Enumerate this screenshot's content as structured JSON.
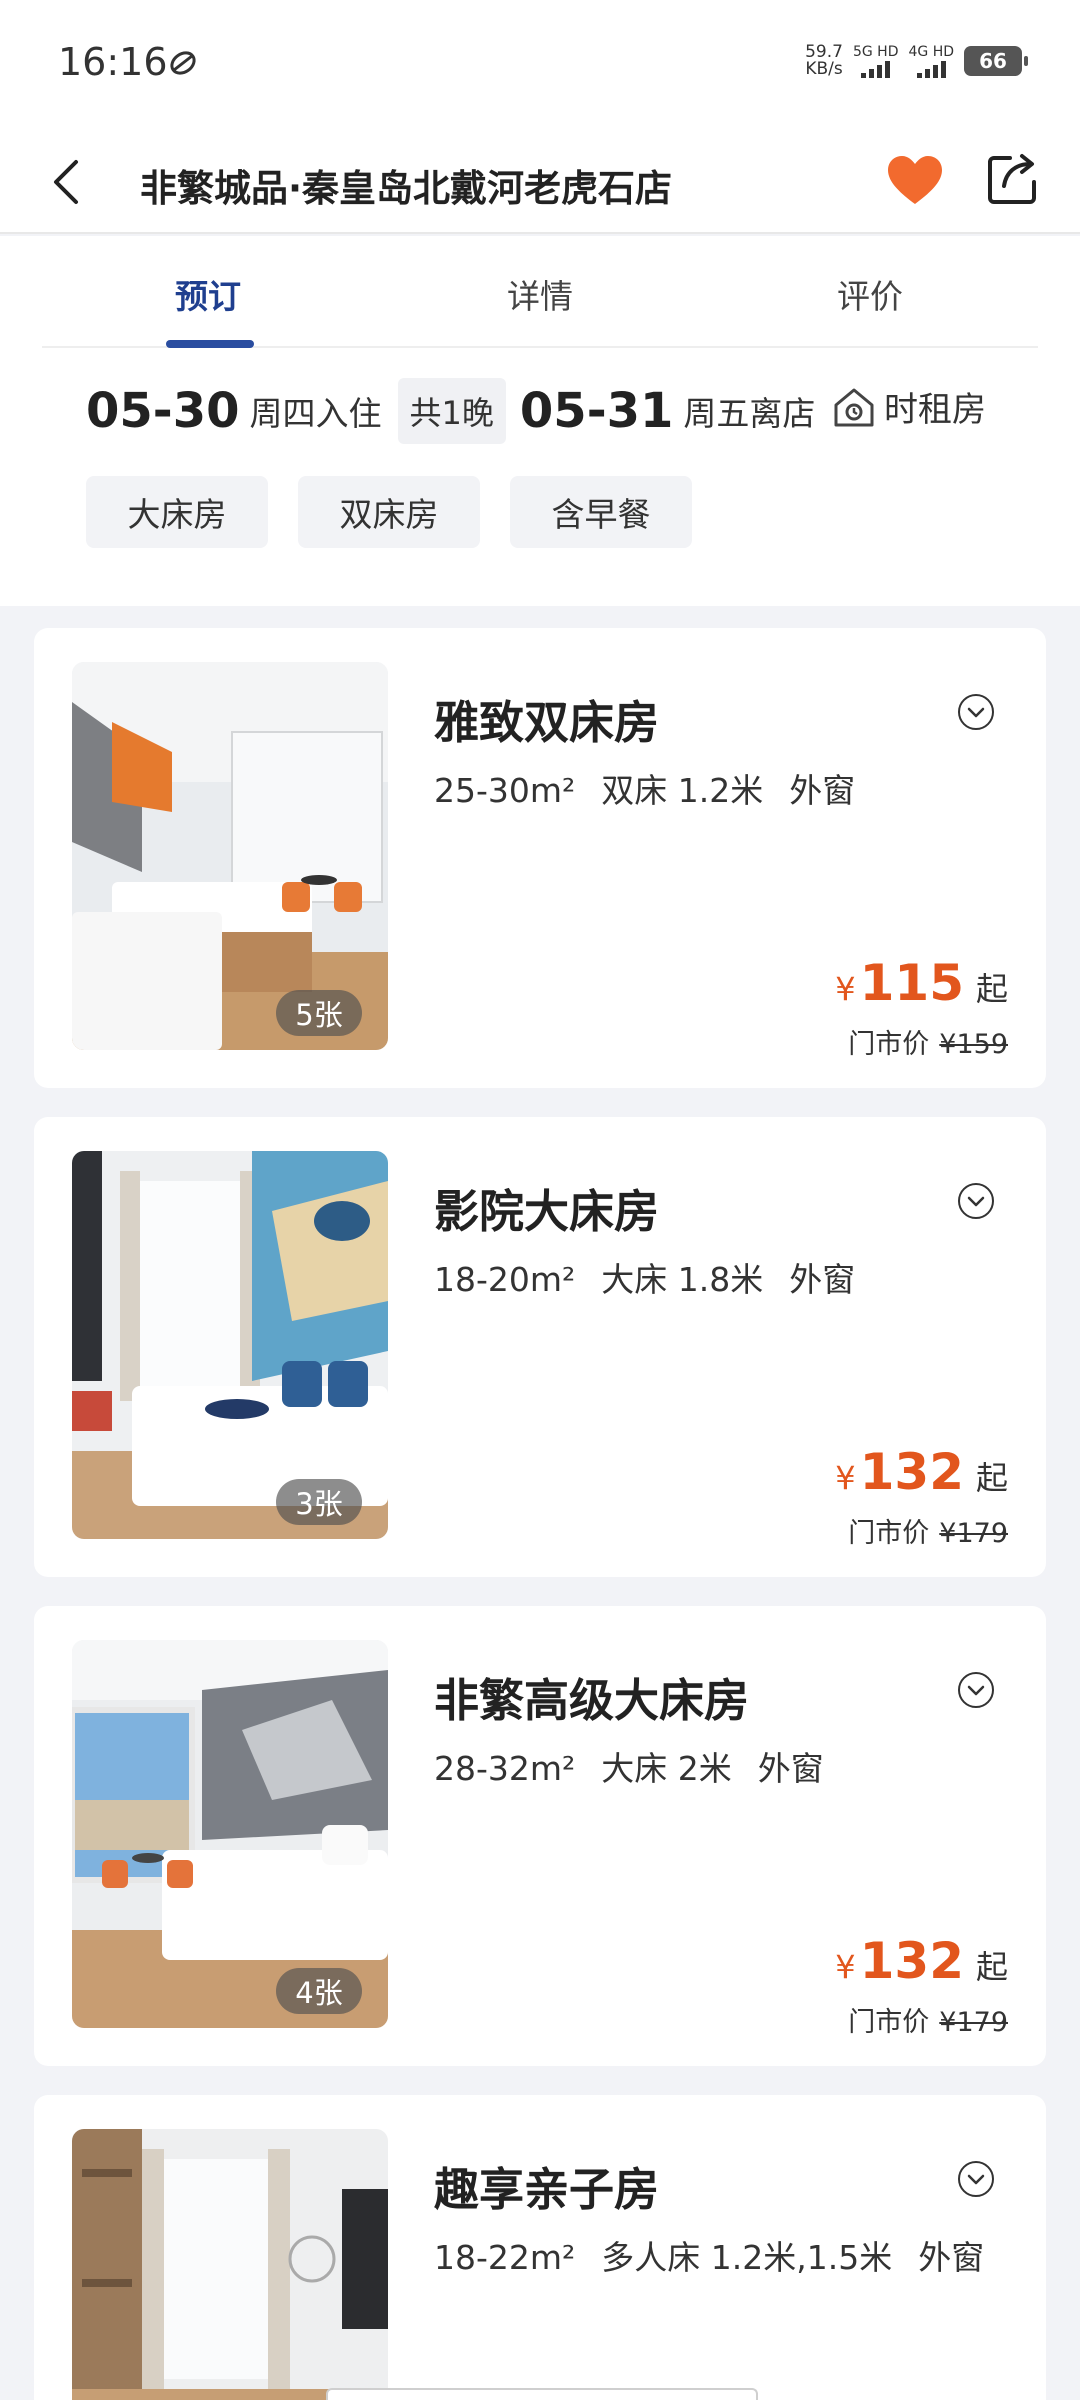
{
  "status": {
    "time": "16:16",
    "speed_value": "59.7",
    "speed_unit": "KB/s",
    "net1": "5G HD",
    "net2": "4G HD",
    "battery": "66"
  },
  "header": {
    "title": "非繁城品·秦皇岛北戴河老虎石店",
    "favorite_color": "#f26a2e"
  },
  "tabs": [
    {
      "label": "预订",
      "active": true
    },
    {
      "label": "详情",
      "active": false
    },
    {
      "label": "评价",
      "active": false
    }
  ],
  "dates": {
    "checkin_date": "05-30",
    "checkin_label": "周四入住",
    "nights": "共1晚",
    "checkout_date": "05-31",
    "checkout_label": "周五离店",
    "hourly_label": "时租房"
  },
  "filters": [
    "大床房",
    "双床房",
    "含早餐"
  ],
  "rooms": [
    {
      "name": "雅致双床房",
      "area": "25-30m²",
      "bed": "双床 1.2米",
      "window": "外窗",
      "photo_count": "5张",
      "currency": "¥",
      "price": "115",
      "price_suffix": "起",
      "market_label": "门市价",
      "market_price": "¥159"
    },
    {
      "name": "影院大床房",
      "area": "18-20m²",
      "bed": "大床 1.8米",
      "window": "外窗",
      "photo_count": "3张",
      "currency": "¥",
      "price": "132",
      "price_suffix": "起",
      "market_label": "门市价",
      "market_price": "¥179"
    },
    {
      "name": "非繁高级大床房",
      "area": "28-32m²",
      "bed": "大床 2米",
      "window": "外窗",
      "photo_count": "4张",
      "currency": "¥",
      "price": "132",
      "price_suffix": "起",
      "market_label": "门市价",
      "market_price": "¥179"
    },
    {
      "name": "趣享亲子房",
      "area": "18-22m²",
      "bed": "多人床 1.2米,1.5米",
      "window": "外窗"
    }
  ],
  "colors": {
    "accent": "#1f3f8f",
    "price": "#e2561d"
  }
}
